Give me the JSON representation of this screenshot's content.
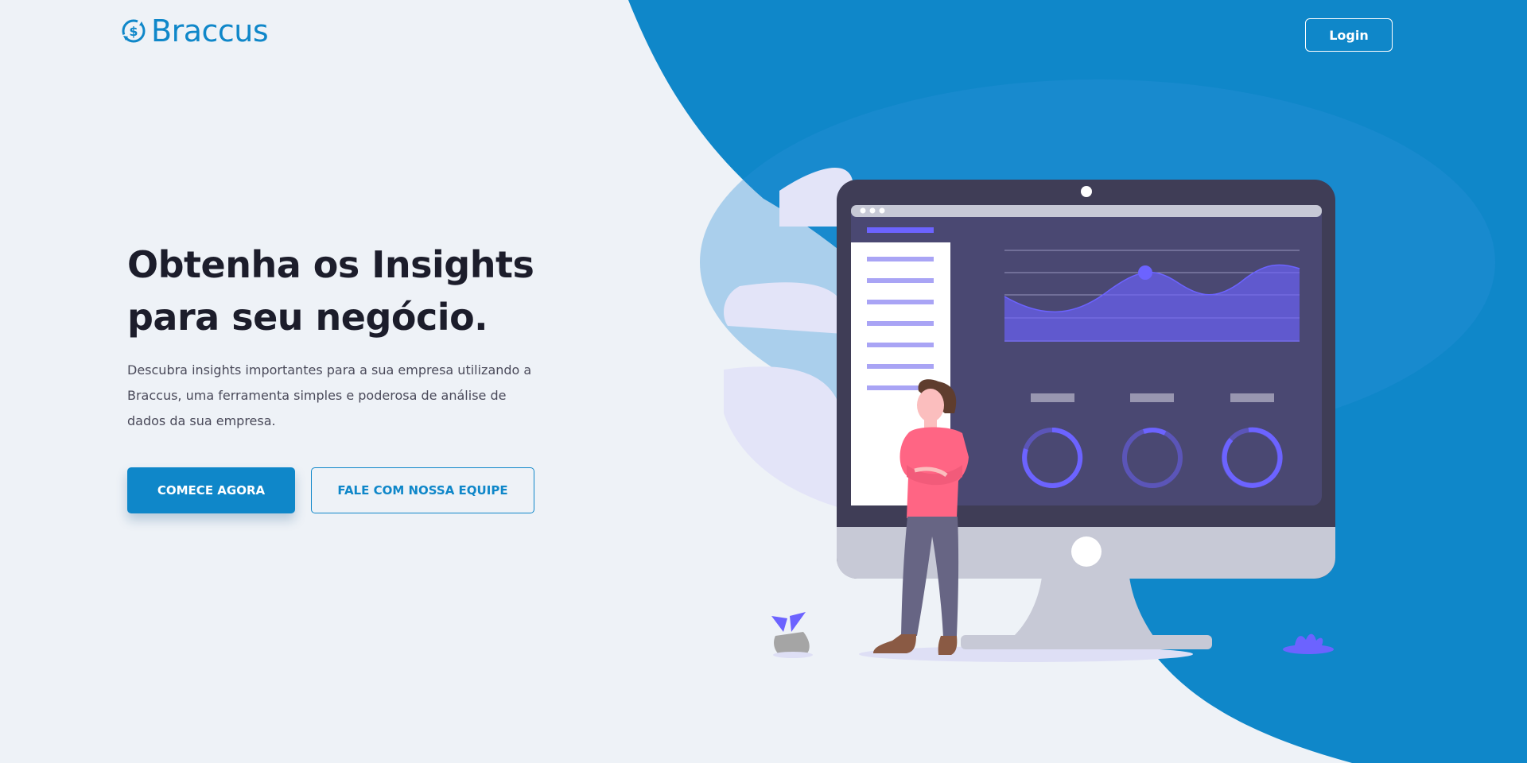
{
  "brand": {
    "name": "Braccus",
    "color": "#0f87c9"
  },
  "header": {
    "login_label": "Login"
  },
  "hero": {
    "title_line1": "Obtenha os Insights",
    "title_line2": "para seu negócio.",
    "description": "Descubra insights importantes para a sua empresa utilizando a Braccus, uma ferramenta simples e poderosa de análise de dados da sua empresa.",
    "primary_cta": "COMECE AGORA",
    "secondary_cta": "FALE COM NOSSA EQUIPE"
  },
  "colors": {
    "background": "#eef2f7",
    "accent_blue": "#0f87c9",
    "title_dark": "#1c1d2b",
    "illustration_purple": "#6c63ff",
    "monitor_dark": "#3f3d56"
  },
  "icons": {
    "logo": "dollar-cycle-icon"
  }
}
